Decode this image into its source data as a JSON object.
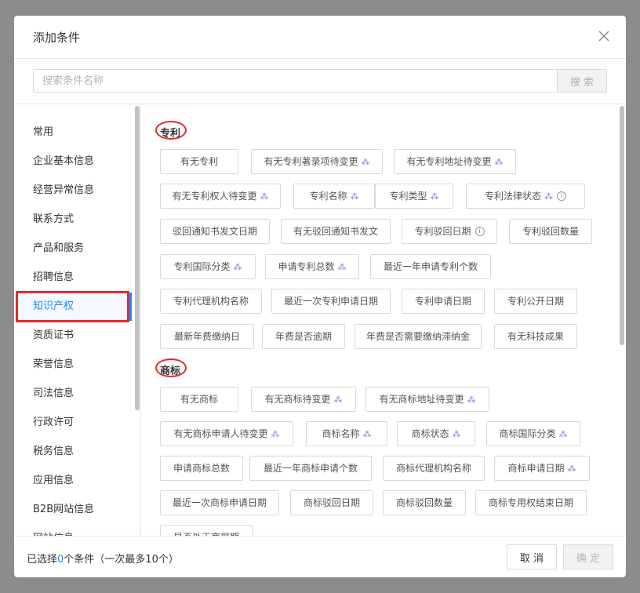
{
  "dialog": {
    "title": "添加条件",
    "close_icon": "close-icon"
  },
  "search": {
    "placeholder": "搜索条件名称",
    "button_label": "搜 索"
  },
  "sidebar": {
    "items": [
      {
        "label": "常用"
      },
      {
        "label": "企业基本信息"
      },
      {
        "label": "经营异常信息"
      },
      {
        "label": "联系方式"
      },
      {
        "label": "产品和服务"
      },
      {
        "label": "招聘信息"
      },
      {
        "label": "知识产权",
        "active": true
      },
      {
        "label": "资质证书"
      },
      {
        "label": "荣誉信息"
      },
      {
        "label": "司法信息"
      },
      {
        "label": "行政许可"
      },
      {
        "label": "税务信息"
      },
      {
        "label": "应用信息"
      },
      {
        "label": "B2B网站信息"
      },
      {
        "label": "网站信息"
      }
    ]
  },
  "sections": [
    {
      "title": "专利",
      "chips": [
        {
          "label": "有无专利"
        },
        {
          "label": "有无专利著录项待变更",
          "vip": true
        },
        {
          "label": "有无专利地址待变更",
          "vip": true
        },
        {
          "label": "有无专利权人待变更",
          "vip": true
        },
        {
          "label": "专利名称",
          "vip": true
        },
        {
          "label": "专利类型",
          "vip": true
        },
        {
          "label": "专利法律状态",
          "vip": true,
          "info": true
        },
        {
          "label": "驳回通知书发文日期"
        },
        {
          "label": "有无驳回通知书发文"
        },
        {
          "label": "专利驳回日期",
          "info": true
        },
        {
          "label": "专利驳回数量"
        },
        {
          "label": "专利国际分类",
          "vip": true
        },
        {
          "label": "申请专利总数",
          "vip": true
        },
        {
          "label": "最近一年申请专利个数"
        },
        {
          "label": "专利代理机构名称"
        },
        {
          "label": "最近一次专利申请日期"
        },
        {
          "label": "专利申请日期"
        },
        {
          "label": "专利公开日期"
        },
        {
          "label": "最新年费缴纳日"
        },
        {
          "label": "年费是否逾期"
        },
        {
          "label": "年费是否需要缴纳滞纳金"
        },
        {
          "label": "有无科技成果"
        }
      ]
    },
    {
      "title": "商标",
      "chips": [
        {
          "label": "有无商标"
        },
        {
          "label": "有无商标待变更",
          "vip": true
        },
        {
          "label": "有无商标地址待变更",
          "vip": true
        },
        {
          "label": "有无商标申请人待变更",
          "vip": true
        },
        {
          "label": "商标名称",
          "vip": true
        },
        {
          "label": "商标状态",
          "vip": true
        },
        {
          "label": "商标国际分类",
          "vip": true
        },
        {
          "label": "申请商标总数"
        },
        {
          "label": "最近一年商标申请个数"
        },
        {
          "label": "商标代理机构名称"
        },
        {
          "label": "商标申请日期",
          "vip": true
        },
        {
          "label": "最近一次商标申请日期"
        },
        {
          "label": "商标驳回日期"
        },
        {
          "label": "商标驳回数量"
        },
        {
          "label": "商标专用权结束日期"
        },
        {
          "label": "是否处于宽展期"
        }
      ]
    }
  ],
  "footer": {
    "prefix": "已选择",
    "count": "0",
    "suffix": "个条件（一次最多10个）",
    "cancel_label": "取 消",
    "ok_label": "确 定"
  },
  "colors": {
    "accent": "#1890ff",
    "highlight_red": "#e52a2a",
    "vip_purple": "#8a6fdf"
  }
}
